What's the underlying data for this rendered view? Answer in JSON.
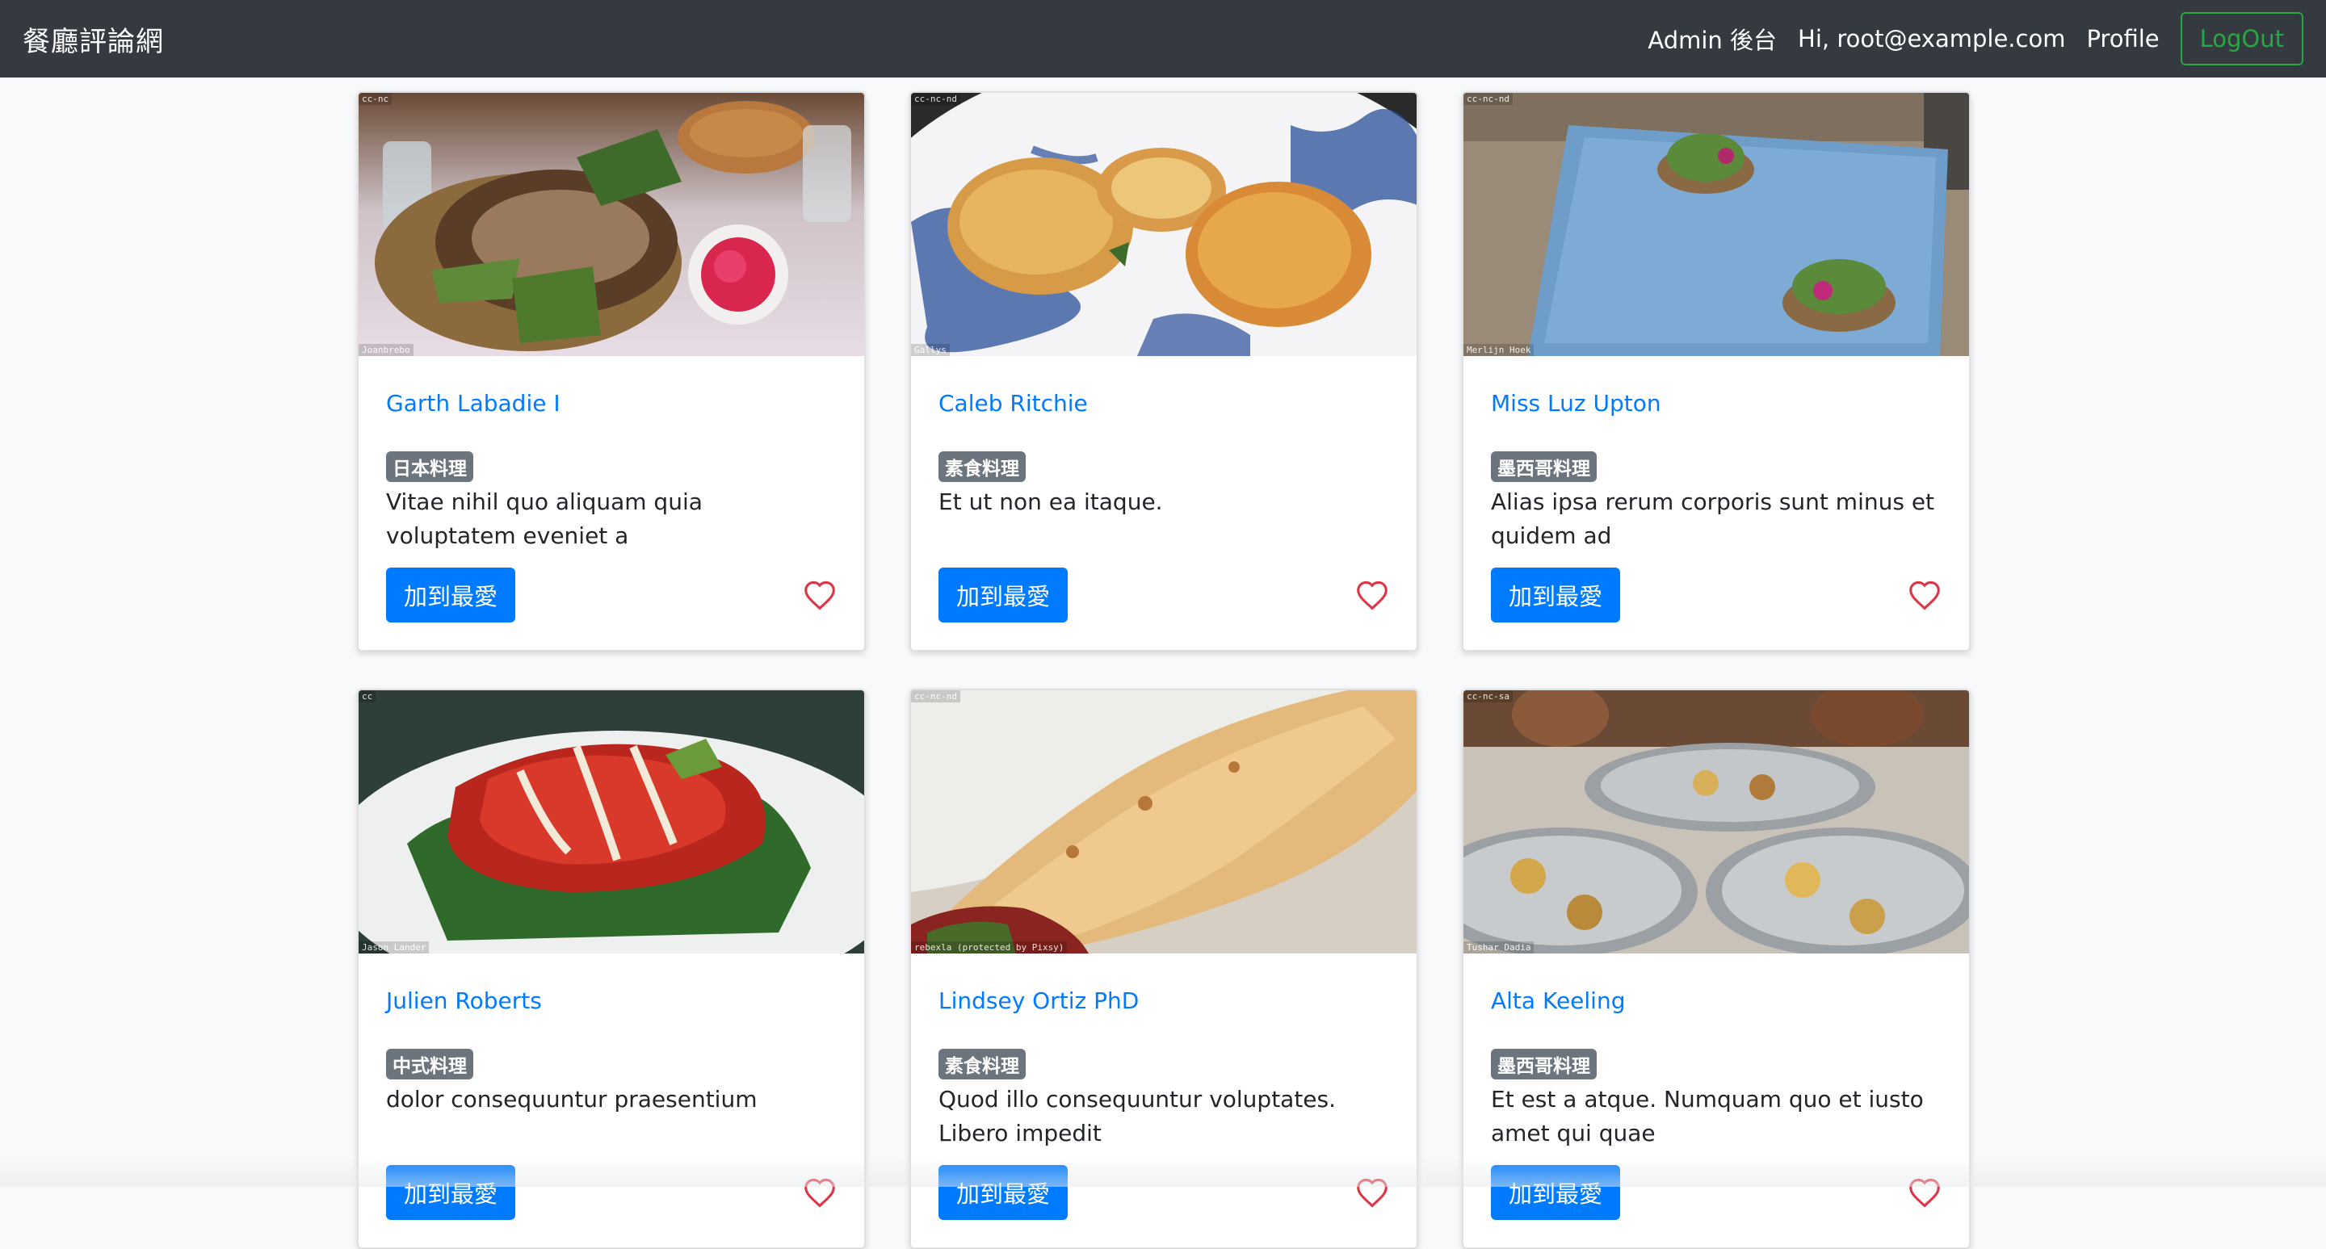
{
  "navbar": {
    "brand": "餐廳評論網",
    "links": [
      "Admin 後台",
      "Hi, root@example.com",
      "Profile"
    ],
    "logout_label": "LogOut"
  },
  "colors": {
    "navbar_bg": "#343a40",
    "primary": "#007bff",
    "badge_bg": "#6c757d",
    "logout_green": "#28a745",
    "heart_red": "#dc3545"
  },
  "restaurants": [
    {
      "name": "Garth Labadie I",
      "category": "日本料理",
      "description": "Vitae nihil quo aliquam quia voluptatem eveniet a",
      "fav_label": "加到最愛",
      "image_alt": "food-photo",
      "license": "cc-nc",
      "credit": "Joanbrebo"
    },
    {
      "name": "Caleb Ritchie",
      "category": "素食料理",
      "description": "Et ut non ea itaque.",
      "fav_label": "加到最愛",
      "image_alt": "food-photo",
      "license": "cc-nc-nd",
      "credit": "Gallys"
    },
    {
      "name": "Miss Luz Upton",
      "category": "墨西哥料理",
      "description": "Alias ipsa rerum corporis sunt minus et quidem ad",
      "fav_label": "加到最愛",
      "image_alt": "food-photo",
      "license": "cc-nc-nd",
      "credit": "Merlijn Hoek"
    },
    {
      "name": "Julien Roberts",
      "category": "中式料理",
      "description": "dolor consequuntur praesentium",
      "fav_label": "加到最愛",
      "image_alt": "food-photo",
      "license": "cc",
      "credit": "Jason Lander"
    },
    {
      "name": "Lindsey Ortiz PhD",
      "category": "素食料理",
      "description": "Quod illo consequuntur voluptates. Libero impedit",
      "fav_label": "加到最愛",
      "image_alt": "food-photo",
      "license": "cc-nc-nd",
      "credit": "rebexla (protected by Pixsy)"
    },
    {
      "name": "Alta Keeling",
      "category": "墨西哥料理",
      "description": "Et est a atque. Numquam quo et iusto amet qui quae",
      "fav_label": "加到最愛",
      "image_alt": "food-photo",
      "license": "cc-nc-sa",
      "credit": "Tushar Dadia"
    }
  ]
}
